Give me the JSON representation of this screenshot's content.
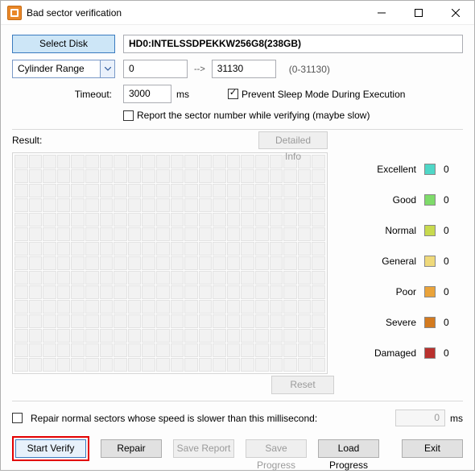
{
  "window": {
    "title": "Bad sector verification"
  },
  "top": {
    "select_disk": "Select Disk",
    "disk_value": "HD0:INTELSSDPEKKW256G8(238GB)"
  },
  "range": {
    "mode": "Cylinder Range",
    "from": "0",
    "to": "31130",
    "hint": "(0-31130)"
  },
  "timeout": {
    "label": "Timeout:",
    "value": "3000",
    "unit": "ms"
  },
  "opts": {
    "prevent_sleep": "Prevent Sleep Mode During Execution",
    "report_sector": "Report the sector number while verifying (maybe slow)"
  },
  "result": {
    "label": "Result:",
    "detailed": "Detailed Info",
    "reset": "Reset"
  },
  "legend": [
    {
      "label": "Excellent",
      "color": "#4fd7c7",
      "count": "0"
    },
    {
      "label": "Good",
      "color": "#7edb6a",
      "count": "0"
    },
    {
      "label": "Normal",
      "color": "#c8da4e",
      "count": "0"
    },
    {
      "label": "General",
      "color": "#efd97a",
      "count": "0"
    },
    {
      "label": "Poor",
      "color": "#eaa33a",
      "count": "0"
    },
    {
      "label": "Severe",
      "color": "#d37a1f",
      "count": "0"
    },
    {
      "label": "Damaged",
      "color": "#b9312e",
      "count": "0"
    }
  ],
  "repair": {
    "label": "Repair normal sectors whose speed is slower than this millisecond:",
    "value": "0",
    "unit": "ms"
  },
  "buttons": {
    "start": "Start Verify",
    "repair": "Repair",
    "save_report": "Save Report",
    "save_progress": "Save Progress",
    "load_progress": "Load Progress",
    "exit": "Exit"
  }
}
